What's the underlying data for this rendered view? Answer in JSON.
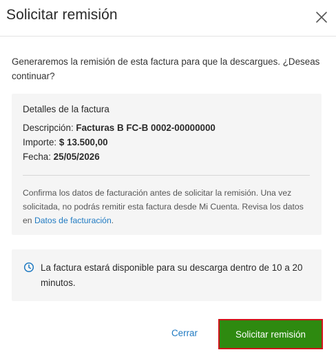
{
  "dialog": {
    "title": "Solicitar remisión",
    "intro": "Generaremos la remisión de esta factura para que la descargues. ¿Deseas continuar?"
  },
  "details": {
    "heading": "Detalles de la factura",
    "description_label": "Descripción:",
    "description_value": "Facturas B FC-B 0002-00000000",
    "amount_label": "Importe:",
    "amount_value": "$ 13.500,00",
    "date_label": "Fecha:",
    "date_value": "25/05/2026",
    "note_text": "Confirma los datos de facturación antes de solicitar la remisión. Una vez solicitada, no podrás remitir esta factura desde Mi Cuenta. Revisa los datos en ",
    "note_link": "Datos de facturación",
    "note_end": "."
  },
  "info": {
    "text": "La factura estará disponible para su descarga dentro de 10 a 20 minutos.",
    "icon": "clock-icon"
  },
  "actions": {
    "cancel_label": "Cerrar",
    "submit_label": "Solicitar remisión"
  },
  "colors": {
    "link": "#1f7ac2",
    "primary": "#2e8a10",
    "highlight": "#d0131a",
    "panel": "#f5f5f5"
  }
}
